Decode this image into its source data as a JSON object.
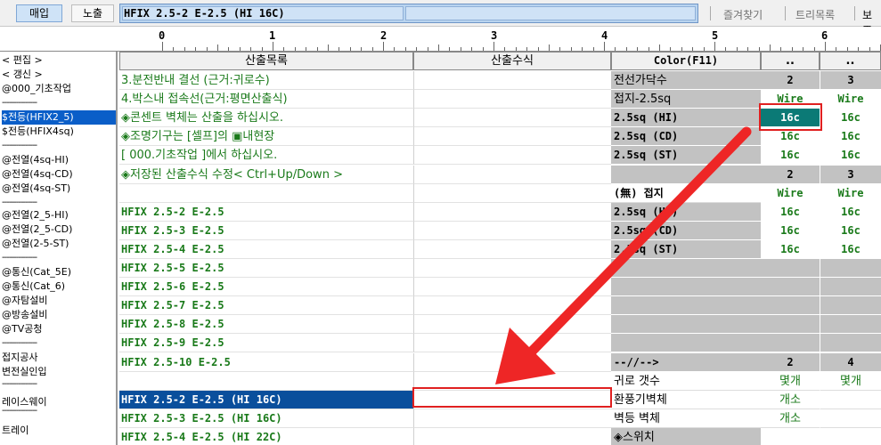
{
  "toolbar": {
    "btn_maeip": "매입",
    "btn_nochul": "노출",
    "formula_value": "HFIX 2.5-2 E-2.5 (HI 16C)",
    "favorites": "즐겨찾기",
    "tree": "트리목록",
    "bo": "보조"
  },
  "ruler": {
    "numbers": [
      "0",
      "1",
      "2",
      "3",
      "4",
      "5",
      "6"
    ]
  },
  "left_panel": {
    "items": [
      "< 편집 >",
      "< 갱신 >",
      "@000_기초작업",
      "---------------",
      "$전등(HFIX2_5)",
      "$전등(HFIX4sq)",
      "---------------",
      "@전열(4sq-HI)",
      "@전열(4sq-CD)",
      "@전열(4sq-ST)",
      "---------------",
      "@전열(2_5-HI)",
      "@전열(2_5-CD)",
      "@전열(2-5-ST)",
      "---------------",
      "@통신(Cat_5E)",
      "@통신(Cat_6)",
      "@자탐설비",
      "@방송설비",
      "@TV공청",
      "---------------",
      "접지공사",
      "변전실인입",
      "---------------",
      "레이스웨이",
      "---------------",
      "트레이"
    ]
  },
  "grid": {
    "headers": [
      "산출목록",
      "산출수식",
      "Color(F11)",
      "..",
      ".."
    ],
    "rows": [
      {
        "list": "  3.분전반내 결선    (근거:귀로수)",
        "color": "전선가닥수",
        "v1": "2",
        "v2": "3"
      },
      {
        "list": "  4.박스내 접속선(근거:평면산출식)",
        "color": "접지-2.5sq",
        "v1": "Wire",
        "v2": "Wire"
      },
      {
        "list": "◈콘센트 벽체는 산출을 하십시오.",
        "color": "2.5sq (HI)",
        "v1": "16c",
        "v2": "16c"
      },
      {
        "list": "◈조명기구는 [셀프]의  ▣내현장",
        "color": "2.5sq (CD)",
        "v1": "16c",
        "v2": "16c"
      },
      {
        "list": "  [ 000.기초작업 ]에서 하십시오.",
        "color": "2.5sq (ST)",
        "v1": "16c",
        "v2": "16c"
      },
      {
        "list": "◈저장된 산출수식 수정< Ctrl+Up/Down >",
        "color": "",
        "v1": "2",
        "v2": "3"
      },
      {
        "list": "",
        "color": "(無) 접지",
        "v1": "Wire",
        "v2": "Wire"
      },
      {
        "list": "HFIX 2.5-2 E-2.5",
        "color": "2.5sq (HI)",
        "v1": "16c",
        "v2": "16c"
      },
      {
        "list": "HFIX 2.5-3 E-2.5",
        "color": "2.5sq (CD)",
        "v1": "16c",
        "v2": "16c"
      },
      {
        "list": "HFIX 2.5-4 E-2.5",
        "color": "2.5sq (ST)",
        "v1": "16c",
        "v2": "16c"
      },
      {
        "list": "HFIX 2.5-5 E-2.5",
        "color": "",
        "v1": "",
        "v2": ""
      },
      {
        "list": "HFIX 2.5-6 E-2.5",
        "color": "",
        "v1": "",
        "v2": ""
      },
      {
        "list": "HFIX 2.5-7 E-2.5",
        "color": "",
        "v1": "",
        "v2": ""
      },
      {
        "list": "HFIX 2.5-8 E-2.5",
        "color": "",
        "v1": "",
        "v2": ""
      },
      {
        "list": "HFIX 2.5-9 E-2.5",
        "color": "",
        "v1": "",
        "v2": ""
      },
      {
        "list": "HFIX 2.5-10 E-2.5",
        "color": "--//-->",
        "v1": "2",
        "v2": "4"
      },
      {
        "list": "",
        "color": "귀로 갯수",
        "v1": "몇개",
        "v2": "몇개"
      },
      {
        "list": "HFIX 2.5-2 E-2.5 (HI 16C)",
        "color": "환풍기벽체",
        "v1": "개소",
        "v2": ""
      },
      {
        "list": "HFIX 2.5-3 E-2.5 (HI 16C)",
        "color": "벽등  벽체",
        "v1": "개소",
        "v2": ""
      },
      {
        "list": "HFIX 2.5-4 E-2.5 (HI 22C)",
        "color": "◈스위치",
        "v1": "",
        "v2": ""
      }
    ]
  }
}
